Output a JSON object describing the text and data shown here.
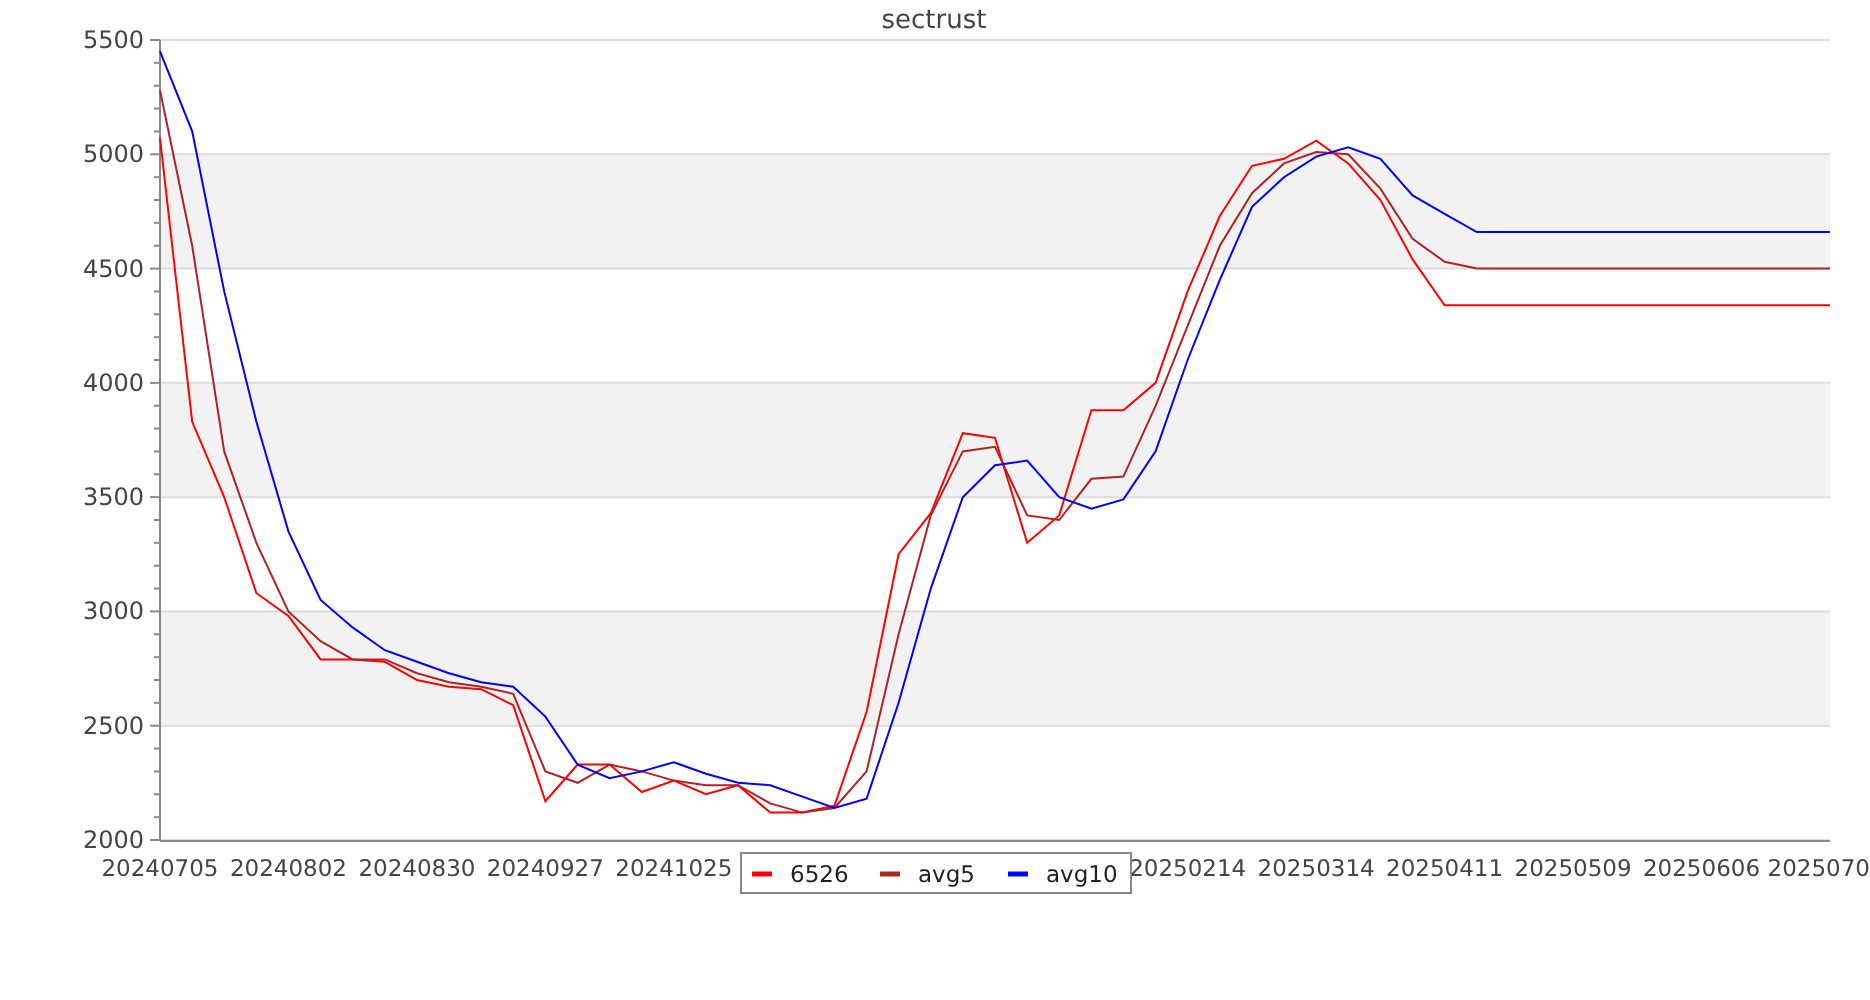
{
  "chart_data": {
    "type": "line",
    "title": "sectrust",
    "categories": [
      "20240705",
      null,
      null,
      null,
      "20240802",
      null,
      null,
      null,
      "20240830",
      null,
      null,
      null,
      "20240927",
      null,
      null,
      null,
      "20241025",
      null,
      null,
      null,
      null,
      null,
      null,
      null,
      null,
      null,
      null,
      null,
      null,
      null,
      null,
      null,
      "20250214",
      null,
      null,
      null,
      "20250314",
      null,
      null,
      null,
      "20250411",
      null,
      null,
      null,
      "20250509",
      null,
      null,
      null,
      "20250606",
      null,
      null,
      null,
      "2025070"
    ],
    "series": [
      {
        "name": "6526",
        "color": "#ff0000",
        "values": [
          5070,
          3830,
          3500,
          3080,
          2980,
          2790,
          2790,
          2780,
          2700,
          2670,
          2660,
          2590,
          2170,
          2330,
          2330,
          2210,
          2260,
          2200,
          2240,
          2120,
          2120,
          2150,
          2560,
          3250,
          3430,
          3780,
          3760,
          3300,
          3420,
          3880,
          3880,
          4000,
          4400,
          4730,
          4950,
          4980,
          5060,
          4960,
          4800,
          4540,
          4340,
          4340,
          4340,
          4340,
          4340,
          4340,
          4340,
          4340,
          4340,
          4340,
          4340,
          4340,
          4340
        ]
      },
      {
        "name": "avg5",
        "color": "#b22222",
        "values": [
          5280,
          4600,
          3700,
          3300,
          3000,
          2870,
          2790,
          2790,
          2730,
          2690,
          2670,
          2640,
          2300,
          2250,
          2330,
          2300,
          2260,
          2240,
          2240,
          2160,
          2120,
          2140,
          2300,
          2900,
          3420,
          3700,
          3720,
          3420,
          3400,
          3580,
          3590,
          3900,
          4250,
          4600,
          4830,
          4960,
          5010,
          5000,
          4850,
          4630,
          4530,
          4500,
          4500,
          4500,
          4500,
          4500,
          4500,
          4500,
          4500,
          4500,
          4500,
          4500,
          4500
        ]
      },
      {
        "name": "avg10",
        "color": "#0000ff",
        "values": [
          5450,
          5100,
          4400,
          3830,
          3350,
          3050,
          2930,
          2830,
          2780,
          2730,
          2690,
          2670,
          2540,
          2330,
          2270,
          2300,
          2340,
          2290,
          2250,
          2240,
          2190,
          2140,
          2180,
          2600,
          3100,
          3500,
          3640,
          3660,
          3500,
          3450,
          3490,
          3700,
          4100,
          4450,
          4770,
          4900,
          4990,
          5030,
          4980,
          4820,
          4740,
          4660,
          4660,
          4660,
          4660,
          4660,
          4660,
          4660,
          4660,
          4660,
          4660,
          4660,
          4660
        ]
      }
    ],
    "ylim": [
      2000,
      5500
    ],
    "grid": true,
    "legend": true,
    "yticks": [
      2000,
      2500,
      3000,
      3500,
      4000,
      4500,
      5000,
      5500
    ]
  }
}
